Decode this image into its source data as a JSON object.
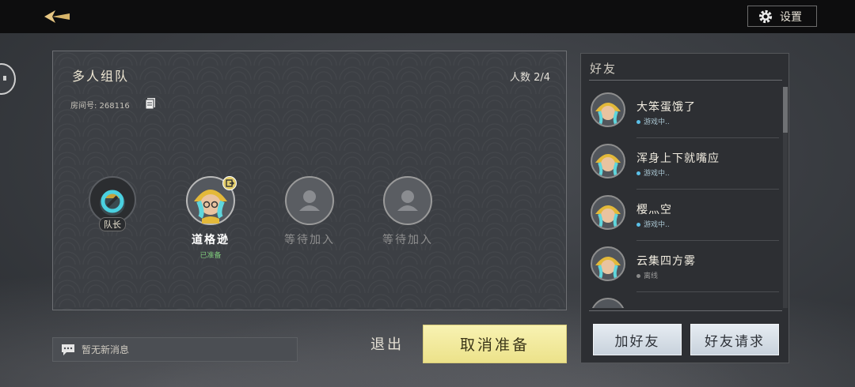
{
  "header": {
    "settings_label": "设置"
  },
  "team": {
    "title": "多人组队",
    "member_count": "人数 2/4",
    "room_no": "房间号: 268116",
    "slots": [
      {
        "type": "leader",
        "tag": "队长"
      },
      {
        "type": "member",
        "name": "道格逊",
        "status": "已准备"
      },
      {
        "type": "empty",
        "name": "等待加入"
      },
      {
        "type": "empty",
        "name": "等待加入"
      }
    ]
  },
  "message_bar": {
    "text": "暂无新消息"
  },
  "actions": {
    "quit_label": "退出",
    "cancel_ready_label": "取消准备"
  },
  "friends": {
    "title": "好友",
    "items": [
      {
        "name": "大笨蛋饿了",
        "status": "游戏中..",
        "status_color": "#5bc0e8"
      },
      {
        "name": "浑身上下就嘴应",
        "status": "游戏中..",
        "status_color": "#5bc0e8"
      },
      {
        "name": "樱灬空",
        "status": "游戏中..",
        "status_color": "#5bc0e8"
      },
      {
        "name": "云集四方雾",
        "status": "离线",
        "status_color": "#8a8a8a"
      }
    ],
    "add_friend_label": "加好友",
    "friend_request_label": "好友请求"
  },
  "colors": {
    "accent_yellow": "#ece28a",
    "ready_green": "#7dc87a"
  },
  "icons": [
    "back-arrow-icon",
    "gear-icon",
    "chat-icon",
    "copy-icon",
    "user-silhouette-icon",
    "exit-icon",
    "message-icon"
  ]
}
